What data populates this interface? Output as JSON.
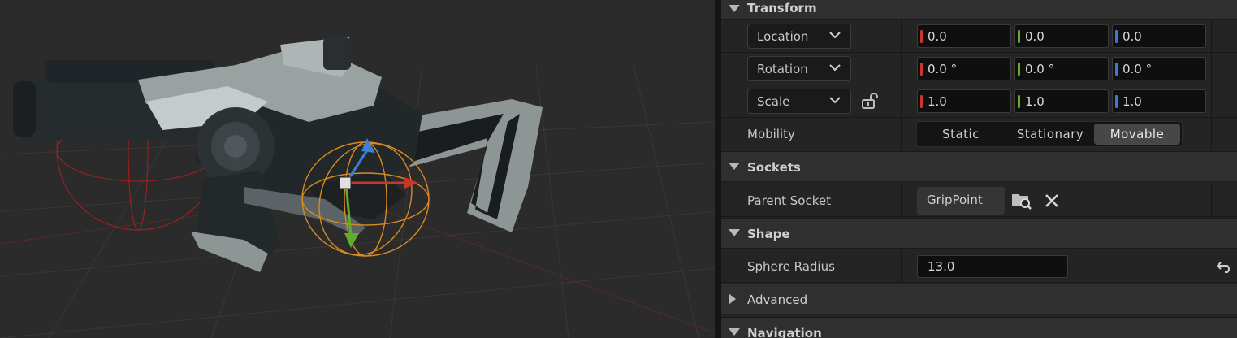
{
  "viewport": {
    "gizmo_colors": {
      "x": "#d23b2a",
      "y": "#5fae2d",
      "z": "#3b82d6"
    },
    "collision_color": "#e0962a"
  },
  "details": {
    "transform": {
      "title": "Transform",
      "location": {
        "label": "Location",
        "x": "0.0",
        "y": "0.0",
        "z": "0.0"
      },
      "rotation": {
        "label": "Rotation",
        "x": "0.0 °",
        "y": "0.0 °",
        "z": "0.0 °"
      },
      "scale": {
        "label": "Scale",
        "x": "1.0",
        "y": "1.0",
        "z": "1.0"
      },
      "mobility": {
        "label": "Mobility",
        "options": [
          "Static",
          "Stationary",
          "Movable"
        ],
        "selected": "Movable"
      }
    },
    "sockets": {
      "title": "Sockets",
      "parent_socket": {
        "label": "Parent Socket",
        "value": "GripPoint"
      }
    },
    "shape": {
      "title": "Shape",
      "sphere_radius": {
        "label": "Sphere Radius",
        "value": "13.0"
      }
    },
    "advanced": {
      "title": "Advanced"
    },
    "navigation": {
      "title": "Navigation"
    }
  },
  "colors": {
    "axis_x": "#c8362c",
    "axis_y": "#68a82e",
    "axis_z": "#3a7bd5"
  }
}
